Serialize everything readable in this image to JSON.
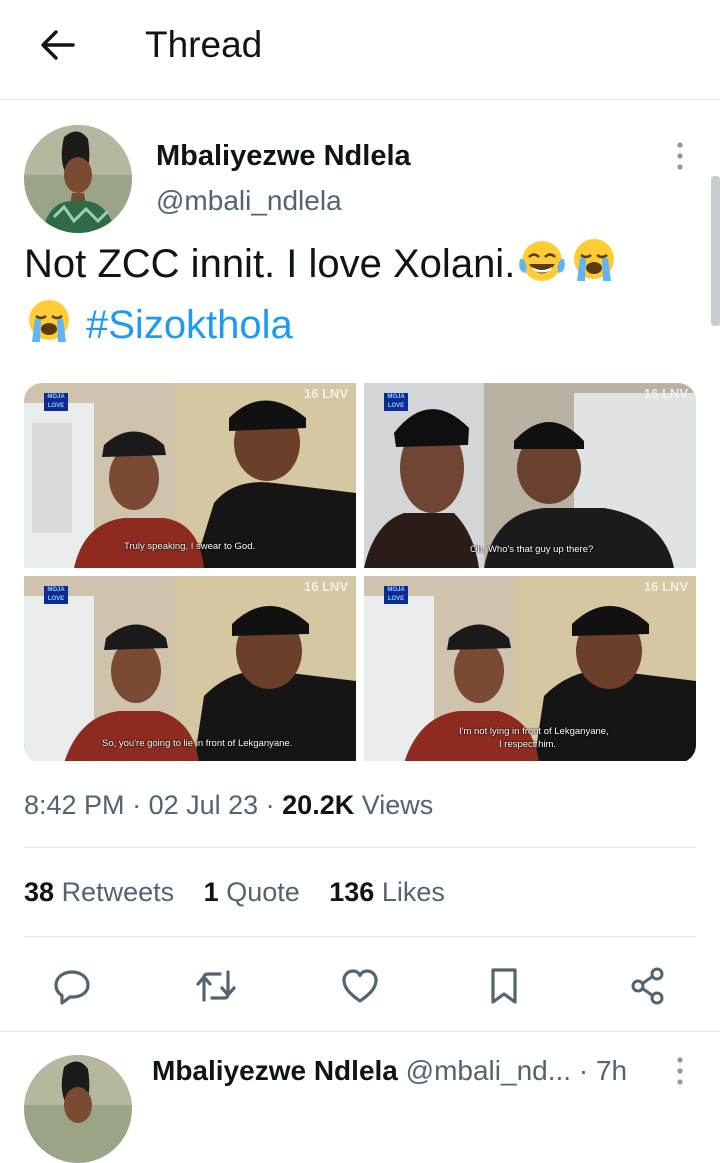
{
  "header": {
    "title": "Thread",
    "back_icon": "arrow-left-icon"
  },
  "tweet": {
    "author_name": "Mbaliyezwe Ndlela",
    "author_handle": "@mbali_ndlela",
    "text": "Not ZCC innit. I love Xolani.",
    "hashtag": "#Sizokthola",
    "media": [
      {
        "caption": "Truly speaking, I swear to God.",
        "watermark": "16 LNV",
        "logo": "MOJA LOVE"
      },
      {
        "caption": "Oh. Who's that guy up there?",
        "watermark": "16 LNV",
        "logo": "MOJA LOVE"
      },
      {
        "caption": "So, you're going to lie in front of Lekganyane.",
        "watermark": "16 LNV",
        "logo": "MOJA LOVE"
      },
      {
        "caption": "I'm not lying in front of Lekganyane,",
        "caption2": "I respect him.",
        "watermark": "16 LNV",
        "logo": "MOJA LOVE"
      }
    ],
    "time": "8:42 PM",
    "date": "02 Jul 23",
    "views_count": "20.2K",
    "views_label": "Views",
    "retweets_count": "38",
    "retweets_label": "Retweets",
    "quotes_count": "1",
    "quotes_label": "Quote",
    "likes_count": "136",
    "likes_label": "Likes"
  },
  "actions": [
    "reply-icon",
    "retweet-icon",
    "like-icon",
    "bookmark-icon",
    "share-icon"
  ],
  "reply": {
    "author_name": "Mbaliyezwe Ndlela",
    "author_handle": "@mbali_nd...",
    "time_ago": "7h"
  },
  "colors": {
    "accent": "#1d9bf0",
    "text": "#0f1419",
    "secondary": "#536471",
    "divider": "#e6e9eb"
  }
}
